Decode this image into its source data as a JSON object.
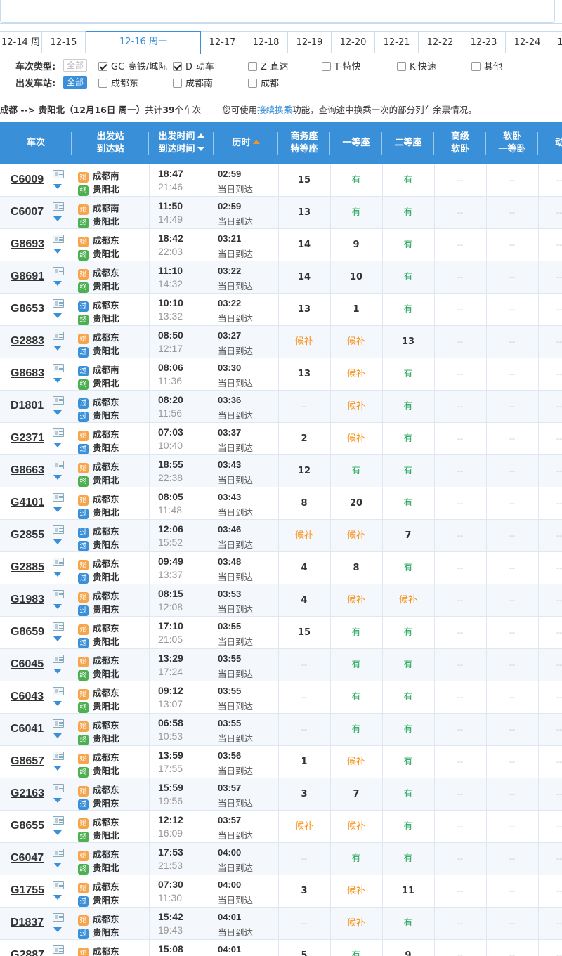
{
  "date_tabs": [
    {
      "label": "12-14 周",
      "w": 60
    },
    {
      "label": "12-15",
      "w": 62
    },
    {
      "label": "12-16 周一",
      "w": 164,
      "active": true
    },
    {
      "label": "12-17",
      "w": 62
    },
    {
      "label": "12-18",
      "w": 62
    },
    {
      "label": "12-19",
      "w": 62
    },
    {
      "label": "12-20",
      "w": 62
    },
    {
      "label": "12-21",
      "w": 62
    },
    {
      "label": "12-22",
      "w": 62
    },
    {
      "label": "12-23",
      "w": 62
    },
    {
      "label": "12-24",
      "w": 62
    },
    {
      "label": "12",
      "w": 30
    }
  ],
  "filters": {
    "type_label": "车次类型:",
    "type_all": "全部",
    "type_options": [
      {
        "label": "GC-高铁/城际",
        "checked": true
      },
      {
        "label": "D-动车",
        "checked": true
      },
      {
        "label": "Z-直达",
        "checked": false
      },
      {
        "label": "T-特快",
        "checked": false
      },
      {
        "label": "K-快速",
        "checked": false
      },
      {
        "label": "其他",
        "checked": false
      }
    ],
    "station_label": "出发车站:",
    "station_all": "全部",
    "station_options": [
      {
        "label": "成都东",
        "checked": false
      },
      {
        "label": "成都南",
        "checked": false
      },
      {
        "label": "成都",
        "checked": false
      }
    ]
  },
  "summary": {
    "route": "成都 --> 贵阳北（12月16日 周一）",
    "count_prefix": "共计",
    "count": "39",
    "count_suffix": "个车次",
    "hint_prefix": "您可使用",
    "hint_link": "接续换乘",
    "hint_suffix": "功能，查询途中换乘一次的部分列车余票情况。"
  },
  "headers": {
    "train": "车次",
    "station_from": "出发站",
    "station_to": "到达站",
    "dep_time": "出发时间",
    "arr_time": "到达时间",
    "duration": "历时",
    "business_1": "商务座",
    "business_2": "特等座",
    "first": "一等座",
    "second": "二等座",
    "adv_soft_1": "高级",
    "adv_soft_2": "软卧",
    "soft_1": "软卧",
    "soft_2": "一等卧",
    "extra": "动"
  },
  "badges": {
    "start": "始",
    "pass": "过",
    "end": "终"
  },
  "rows": [
    {
      "train": "C6009",
      "from": "成都南",
      "from_type": "start",
      "to": "贵阳北",
      "to_type": "end",
      "dep": "18:47",
      "arr": "21:46",
      "dur": "02:59",
      "day": "当日到达",
      "biz": "15",
      "first": "有",
      "second": "有"
    },
    {
      "train": "C6007",
      "from": "成都南",
      "from_type": "start",
      "to": "贵阳北",
      "to_type": "end",
      "dep": "11:50",
      "arr": "14:49",
      "dur": "02:59",
      "day": "当日到达",
      "biz": "13",
      "first": "有",
      "second": "有"
    },
    {
      "train": "G8693",
      "from": "成都东",
      "from_type": "start",
      "to": "贵阳北",
      "to_type": "end",
      "dep": "18:42",
      "arr": "22:03",
      "dur": "03:21",
      "day": "当日到达",
      "biz": "14",
      "first": "9",
      "second": "有"
    },
    {
      "train": "G8691",
      "from": "成都东",
      "from_type": "start",
      "to": "贵阳北",
      "to_type": "end",
      "dep": "11:10",
      "arr": "14:32",
      "dur": "03:22",
      "day": "当日到达",
      "biz": "14",
      "first": "10",
      "second": "有"
    },
    {
      "train": "G8653",
      "from": "成都东",
      "from_type": "pass",
      "to": "贵阳北",
      "to_type": "end",
      "dep": "10:10",
      "arr": "13:32",
      "dur": "03:22",
      "day": "当日到达",
      "biz": "13",
      "first": "1",
      "second": "有"
    },
    {
      "train": "G2883",
      "from": "成都东",
      "from_type": "start",
      "to": "贵阳北",
      "to_type": "pass",
      "dep": "08:50",
      "arr": "12:17",
      "dur": "03:27",
      "day": "当日到达",
      "biz": "候补",
      "first": "候补",
      "second": "13"
    },
    {
      "train": "G8683",
      "from": "成都南",
      "from_type": "pass",
      "to": "贵阳北",
      "to_type": "end",
      "dep": "08:06",
      "arr": "11:36",
      "dur": "03:30",
      "day": "当日到达",
      "biz": "13",
      "first": "候补",
      "second": "有"
    },
    {
      "train": "D1801",
      "from": "成都东",
      "from_type": "pass",
      "to": "贵阳东",
      "to_type": "pass",
      "dep": "08:20",
      "arr": "11:56",
      "dur": "03:36",
      "day": "当日到达",
      "biz": "--",
      "first": "候补",
      "second": "有"
    },
    {
      "train": "G2371",
      "from": "成都东",
      "from_type": "start",
      "to": "贵阳东",
      "to_type": "pass",
      "dep": "07:03",
      "arr": "10:40",
      "dur": "03:37",
      "day": "当日到达",
      "biz": "2",
      "first": "候补",
      "second": "有"
    },
    {
      "train": "G8663",
      "from": "成都东",
      "from_type": "start",
      "to": "贵阳北",
      "to_type": "end",
      "dep": "18:55",
      "arr": "22:38",
      "dur": "03:43",
      "day": "当日到达",
      "biz": "12",
      "first": "有",
      "second": "有"
    },
    {
      "train": "G4101",
      "from": "成都东",
      "from_type": "start",
      "to": "贵阳北",
      "to_type": "pass",
      "dep": "08:05",
      "arr": "11:48",
      "dur": "03:43",
      "day": "当日到达",
      "biz": "8",
      "first": "20",
      "second": "有"
    },
    {
      "train": "G2855",
      "from": "成都东",
      "from_type": "pass",
      "to": "贵阳东",
      "to_type": "pass",
      "dep": "12:06",
      "arr": "15:52",
      "dur": "03:46",
      "day": "当日到达",
      "biz": "候补",
      "first": "候补",
      "second": "7"
    },
    {
      "train": "G2885",
      "from": "成都东",
      "from_type": "start",
      "to": "贵阳北",
      "to_type": "pass",
      "dep": "09:49",
      "arr": "13:37",
      "dur": "03:48",
      "day": "当日到达",
      "biz": "4",
      "first": "8",
      "second": "有"
    },
    {
      "train": "G1983",
      "from": "成都东",
      "from_type": "start",
      "to": "贵阳东",
      "to_type": "pass",
      "dep": "08:15",
      "arr": "12:08",
      "dur": "03:53",
      "day": "当日到达",
      "biz": "4",
      "first": "候补",
      "second": "候补"
    },
    {
      "train": "G8659",
      "from": "成都东",
      "from_type": "start",
      "to": "贵阳北",
      "to_type": "pass",
      "dep": "17:10",
      "arr": "21:05",
      "dur": "03:55",
      "day": "当日到达",
      "biz": "15",
      "first": "有",
      "second": "有"
    },
    {
      "train": "C6045",
      "from": "成都东",
      "from_type": "start",
      "to": "贵阳北",
      "to_type": "end",
      "dep": "13:29",
      "arr": "17:24",
      "dur": "03:55",
      "day": "当日到达",
      "biz": "--",
      "first": "有",
      "second": "有"
    },
    {
      "train": "C6043",
      "from": "成都东",
      "from_type": "start",
      "to": "贵阳北",
      "to_type": "end",
      "dep": "09:12",
      "arr": "13:07",
      "dur": "03:55",
      "day": "当日到达",
      "biz": "--",
      "first": "有",
      "second": "有"
    },
    {
      "train": "C6041",
      "from": "成都东",
      "from_type": "start",
      "to": "贵阳北",
      "to_type": "end",
      "dep": "06:58",
      "arr": "10:53",
      "dur": "03:55",
      "day": "当日到达",
      "biz": "--",
      "first": "有",
      "second": "有"
    },
    {
      "train": "G8657",
      "from": "成都东",
      "from_type": "start",
      "to": "贵阳北",
      "to_type": "end",
      "dep": "13:59",
      "arr": "17:55",
      "dur": "03:56",
      "day": "当日到达",
      "biz": "1",
      "first": "候补",
      "second": "有"
    },
    {
      "train": "G2163",
      "from": "成都东",
      "from_type": "start",
      "to": "贵阳东",
      "to_type": "pass",
      "dep": "15:59",
      "arr": "19:56",
      "dur": "03:57",
      "day": "当日到达",
      "biz": "3",
      "first": "7",
      "second": "有"
    },
    {
      "train": "G8655",
      "from": "成都东",
      "from_type": "start",
      "to": "贵阳北",
      "to_type": "end",
      "dep": "12:12",
      "arr": "16:09",
      "dur": "03:57",
      "day": "当日到达",
      "biz": "候补",
      "first": "候补",
      "second": "有"
    },
    {
      "train": "C6047",
      "from": "成都东",
      "from_type": "start",
      "to": "贵阳北",
      "to_type": "end",
      "dep": "17:53",
      "arr": "21:53",
      "dur": "04:00",
      "day": "当日到达",
      "biz": "--",
      "first": "有",
      "second": "有"
    },
    {
      "train": "G1755",
      "from": "成都东",
      "from_type": "start",
      "to": "贵阳东",
      "to_type": "pass",
      "dep": "07:30",
      "arr": "11:30",
      "dur": "04:00",
      "day": "当日到达",
      "biz": "3",
      "first": "候补",
      "second": "11"
    },
    {
      "train": "D1837",
      "from": "成都东",
      "from_type": "start",
      "to": "贵阳东",
      "to_type": "pass",
      "dep": "15:42",
      "arr": "19:43",
      "dur": "04:01",
      "day": "当日到达",
      "biz": "--",
      "first": "候补",
      "second": "有"
    },
    {
      "train": "G2887",
      "from": "成都东",
      "from_type": "start",
      "to": "贵阳北",
      "to_type": "pass",
      "dep": "15:08",
      "arr": "19:09",
      "dur": "04:01",
      "day": "当日到达",
      "biz": "5",
      "first": "有",
      "second": "9"
    }
  ],
  "na": "--",
  "colors": {
    "accent": "#3a8fd9",
    "available": "#26a65b",
    "waitlist": "#f7941d",
    "start_badge": "#f7a44a",
    "end_badge": "#4caf50"
  }
}
